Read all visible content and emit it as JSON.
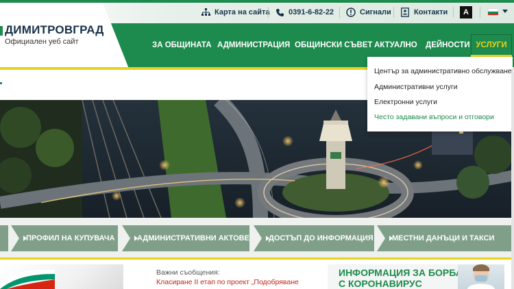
{
  "site": {
    "title": "ДИМИТРОВГРАД",
    "subtitle": "Официален уеб сайт"
  },
  "utility": {
    "sitemap": "Карта на сайта",
    "phone": "0391-6-82-22",
    "signals": "Сигнали",
    "contacts": "Контакти",
    "accessibility": "A"
  },
  "nav": {
    "items": [
      "ЗА ОБЩИНАТА",
      "АДМИНИСТРАЦИЯ",
      "ОБЩИНСКИ СЪВЕТ",
      "АКТУАЛНО",
      "ДЕЙНОСТИ"
    ],
    "active": "УСЛУГИ"
  },
  "dropdown": {
    "items": [
      "Център за административно обслужване",
      "Административни услуги",
      "Електронни услуги",
      "Често задавани въпроси и отговори"
    ]
  },
  "quick_links": [
    "ПРОФИЛ НА КУПУВАЧА",
    "АДМИНИСТРАТИВНИ АКТОВЕ",
    "ДОСТЪП ДО ИНФОРМАЦИЯ",
    "МЕСТНИ ДАНЪЦИ И ТАКСИ"
  ],
  "news": {
    "label": "Важни съобщения:",
    "title": "Класиране II етап по проект „Подобряване"
  },
  "covid": {
    "line1": "ИНФОРМАЦИЯ ЗА БОРБА",
    "line2": "С КОРОНАВИРУС"
  },
  "colors": {
    "brand_green": "#1d8a4e",
    "accent_yellow": "#e7d21c",
    "quick_link_bg": "#7f9f89",
    "news_red": "#c0241b"
  },
  "icons": {
    "sitemap": "sitemap-icon",
    "phone": "phone-icon",
    "signals": "alert-icon",
    "contacts": "contact-card-icon",
    "language": "bulgarian-flag-icon"
  }
}
